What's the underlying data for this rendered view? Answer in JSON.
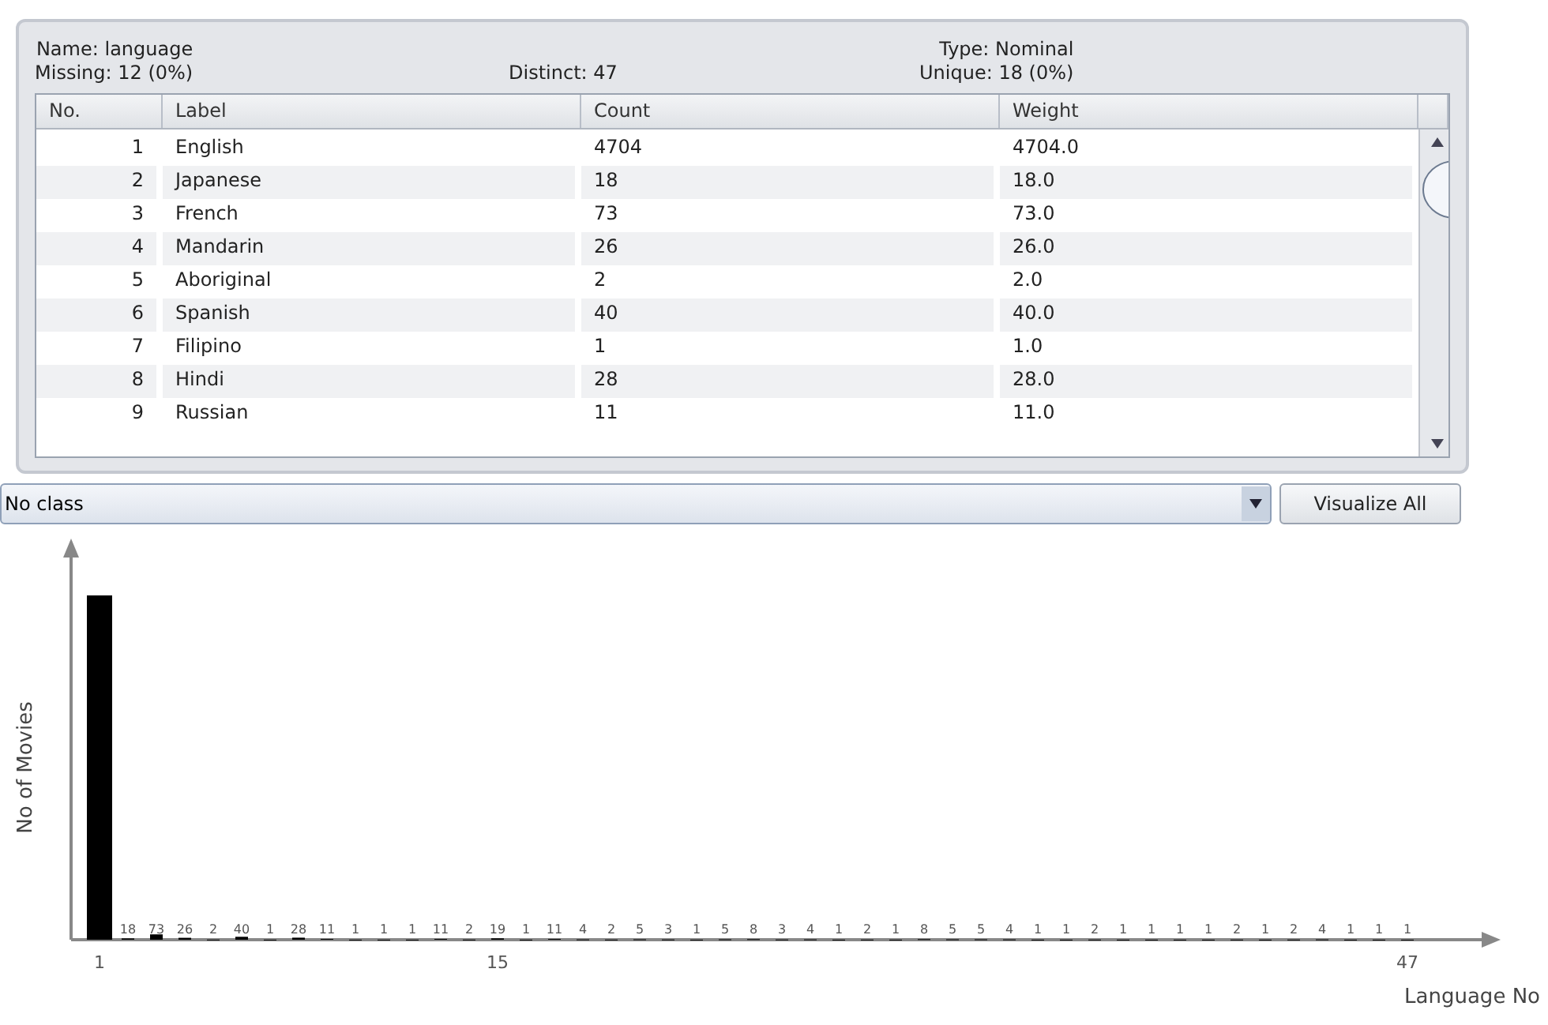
{
  "attribute": {
    "name_label": "Name:",
    "name": "language",
    "missing_label": "Missing:",
    "missing": "12 (0%)",
    "distinct_label": "Distinct:",
    "distinct": "47",
    "type_label": "Type:",
    "type": "Nominal",
    "unique_label": "Unique:",
    "unique": "18 (0%)"
  },
  "table": {
    "columns": [
      "No.",
      "Label",
      "Count",
      "Weight"
    ],
    "rows": [
      {
        "no": "1",
        "label": "English",
        "count": "4704",
        "weight": "4704.0"
      },
      {
        "no": "2",
        "label": "Japanese",
        "count": "18",
        "weight": "18.0"
      },
      {
        "no": "3",
        "label": "French",
        "count": "73",
        "weight": "73.0"
      },
      {
        "no": "4",
        "label": "Mandarin",
        "count": "26",
        "weight": "26.0"
      },
      {
        "no": "5",
        "label": "Aboriginal",
        "count": "2",
        "weight": "2.0"
      },
      {
        "no": "6",
        "label": "Spanish",
        "count": "40",
        "weight": "40.0"
      },
      {
        "no": "7",
        "label": "Filipino",
        "count": "1",
        "weight": "1.0"
      },
      {
        "no": "8",
        "label": "Hindi",
        "count": "28",
        "weight": "28.0"
      },
      {
        "no": "9",
        "label": "Russian",
        "count": "11",
        "weight": "11.0"
      }
    ]
  },
  "class_select": {
    "value": "No class"
  },
  "visualize_button": "Visualize All",
  "chart_data": {
    "type": "bar",
    "xlabel": "Language No",
    "ylabel": "No of Movies",
    "x": [
      1,
      2,
      3,
      4,
      5,
      6,
      7,
      8,
      9,
      10,
      11,
      12,
      13,
      14,
      15,
      16,
      17,
      18,
      19,
      20,
      21,
      22,
      23,
      24,
      25,
      26,
      27,
      28,
      29,
      30,
      31,
      32,
      33,
      34,
      35,
      36,
      37,
      38,
      39,
      40,
      41,
      42,
      43,
      44,
      45,
      46,
      47
    ],
    "values": [
      4704,
      18,
      73,
      26,
      2,
      40,
      1,
      28,
      11,
      1,
      1,
      1,
      11,
      2,
      19,
      1,
      11,
      4,
      2,
      5,
      3,
      1,
      5,
      8,
      3,
      4,
      1,
      2,
      1,
      8,
      5,
      5,
      4,
      1,
      1,
      2,
      1,
      1,
      1,
      1,
      2,
      1,
      2,
      4,
      1,
      1,
      1
    ],
    "value_labels": [
      null,
      "18",
      "73",
      "26",
      "2",
      "40",
      "1",
      "28",
      "11",
      "1",
      "1",
      "1",
      "11",
      "2",
      "19",
      "1",
      "11",
      "4",
      "2",
      "5",
      "3",
      "1",
      "5",
      "8",
      "3",
      "4",
      "1",
      "2",
      "1",
      "8",
      "5",
      "5",
      "4",
      "1",
      "1",
      "2",
      "1",
      "1",
      "1",
      "1",
      "2",
      "1",
      "2",
      "4",
      "1",
      "1",
      "1"
    ],
    "xticks": [
      1,
      15,
      47
    ],
    "xlim": [
      0,
      50
    ]
  }
}
